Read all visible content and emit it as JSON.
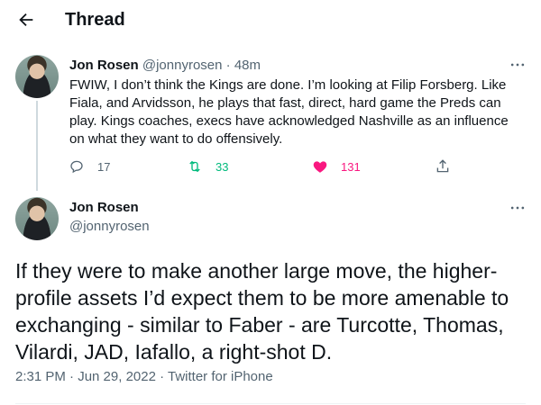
{
  "header": {
    "title": "Thread"
  },
  "tweet1": {
    "name": "Jon Rosen",
    "handle": "@jonnyrosen",
    "separator": "·",
    "time": "48m",
    "text": "FWIW, I don’t think the Kings are done. I’m looking at Filip Forsberg. Like Fiala, and Arvidsson, he plays that fast, direct, hard game the Preds can play. Kings coaches, execs have acknowledged Nashville as an influence on what they want to do offensively.",
    "replies": "17",
    "retweets": "33",
    "likes": "131",
    "liked": true
  },
  "tweet2": {
    "name": "Jon Rosen",
    "handle": "@jonnyrosen",
    "text": "If they were to make another large move, the higher-profile assets I’d expect them to be more amenable to exchanging - similar to Faber - are Turcotte, Thomas, Vilardi, JAD, Iafallo, a right-shot D.",
    "meta": "2:31 PM · Jun 29, 2022 · Twitter for iPhone"
  },
  "colors": {
    "text": "#0f1419",
    "muted": "#536471",
    "retweet_green": "#00ba7c",
    "like_pink": "#f91880",
    "thread_line": "#cfd9de"
  },
  "icons": [
    "back-arrow-icon",
    "more-icon",
    "reply-icon",
    "retweet-icon",
    "heart-icon",
    "share-icon"
  ]
}
